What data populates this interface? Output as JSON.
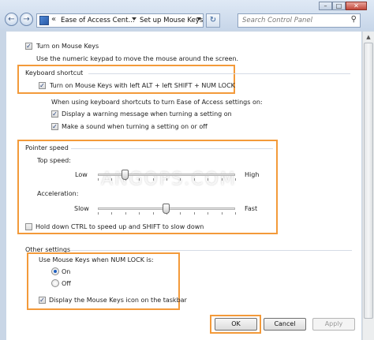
{
  "window": {
    "breadcrumb": [
      "Ease of Access Cent...",
      "Set up Mouse Keys"
    ],
    "breadcrumb_prefix": "«",
    "search_placeholder": "Search Control Panel",
    "buttons": {
      "minimize": "–",
      "maximize": "□",
      "close": "✕"
    }
  },
  "watermark": "ANGOPS.COM",
  "main": {
    "turn_on_label": "Turn on Mouse Keys",
    "turn_on_checked": true,
    "turn_on_description": "Use the numeric keypad to move the mouse around the screen.",
    "keyboard_shortcut": {
      "heading": "Keyboard shortcut",
      "shortcut_label": "Turn on Mouse Keys with left ALT + left SHIFT + NUM LOCK",
      "shortcut_checked": true,
      "subheading": "When using keyboard shortcuts to turn Ease of Access settings on:",
      "warning_label": "Display a warning message when turning a setting on",
      "warning_checked": true,
      "sound_label": "Make a sound when turning a setting on or off",
      "sound_checked": true
    },
    "pointer_speed": {
      "heading": "Pointer speed",
      "top_speed_label": "Top speed:",
      "top_speed_low": "Low",
      "top_speed_high": "High",
      "top_speed_value": 0.2,
      "acceleration_label": "Acceleration:",
      "acceleration_slow": "Slow",
      "acceleration_fast": "Fast",
      "acceleration_value": 0.5,
      "ctrl_shift_label": "Hold down CTRL to speed up and SHIFT to slow down",
      "ctrl_shift_checked": false
    },
    "other_settings": {
      "heading": "Other settings",
      "numlock_label": "Use Mouse Keys when NUM LOCK is:",
      "option_on": "On",
      "option_off": "Off",
      "selected": "On",
      "taskbar_icon_label": "Display the Mouse Keys icon on the taskbar",
      "taskbar_icon_checked": true
    }
  },
  "footer": {
    "ok_label": "OK",
    "cancel_label": "Cancel",
    "apply_label": "Apply"
  },
  "colors": {
    "highlight": "#f39a3a",
    "address_bar": "#dfe9f5"
  }
}
